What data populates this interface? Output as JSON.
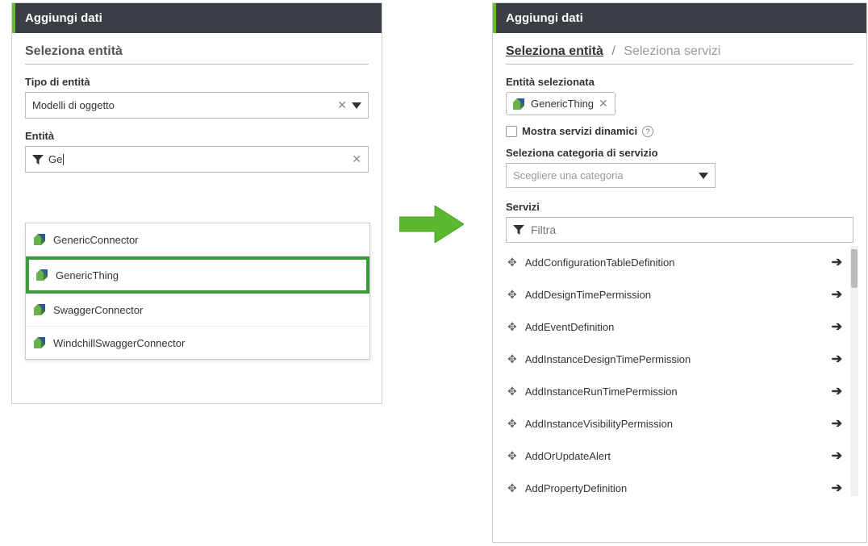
{
  "left": {
    "header": "Aggiungi dati",
    "section_title": "Seleziona entità",
    "entity_type_label": "Tipo di entità",
    "entity_type_value": "Modelli di oggetto",
    "entity_label": "Entità",
    "entity_search_value": "Ge",
    "dropdown": [
      {
        "label": "GenericConnector",
        "highlighted": false
      },
      {
        "label": "GenericThing",
        "highlighted": true
      },
      {
        "label": "SwaggerConnector",
        "highlighted": false
      },
      {
        "label": "WindchillSwaggerConnector",
        "highlighted": false
      }
    ]
  },
  "right": {
    "header": "Aggiungi dati",
    "breadcrumb_active": "Seleziona entità",
    "breadcrumb_inactive": "Seleziona servizi",
    "selected_entity_label": "Entità selezionata",
    "selected_entity_value": "GenericThing",
    "show_dynamic_label": "Mostra servizi dinamici",
    "category_label": "Seleziona categoria di servizio",
    "category_placeholder": "Scegliere una categoria",
    "services_label": "Servizi",
    "filter_placeholder": "Filtra",
    "services": [
      "AddConfigurationTableDefinition",
      "AddDesignTimePermission",
      "AddEventDefinition",
      "AddInstanceDesignTimePermission",
      "AddInstanceRunTimePermission",
      "AddInstanceVisibilityPermission",
      "AddOrUpdateAlert",
      "AddPropertyDefinition"
    ]
  }
}
